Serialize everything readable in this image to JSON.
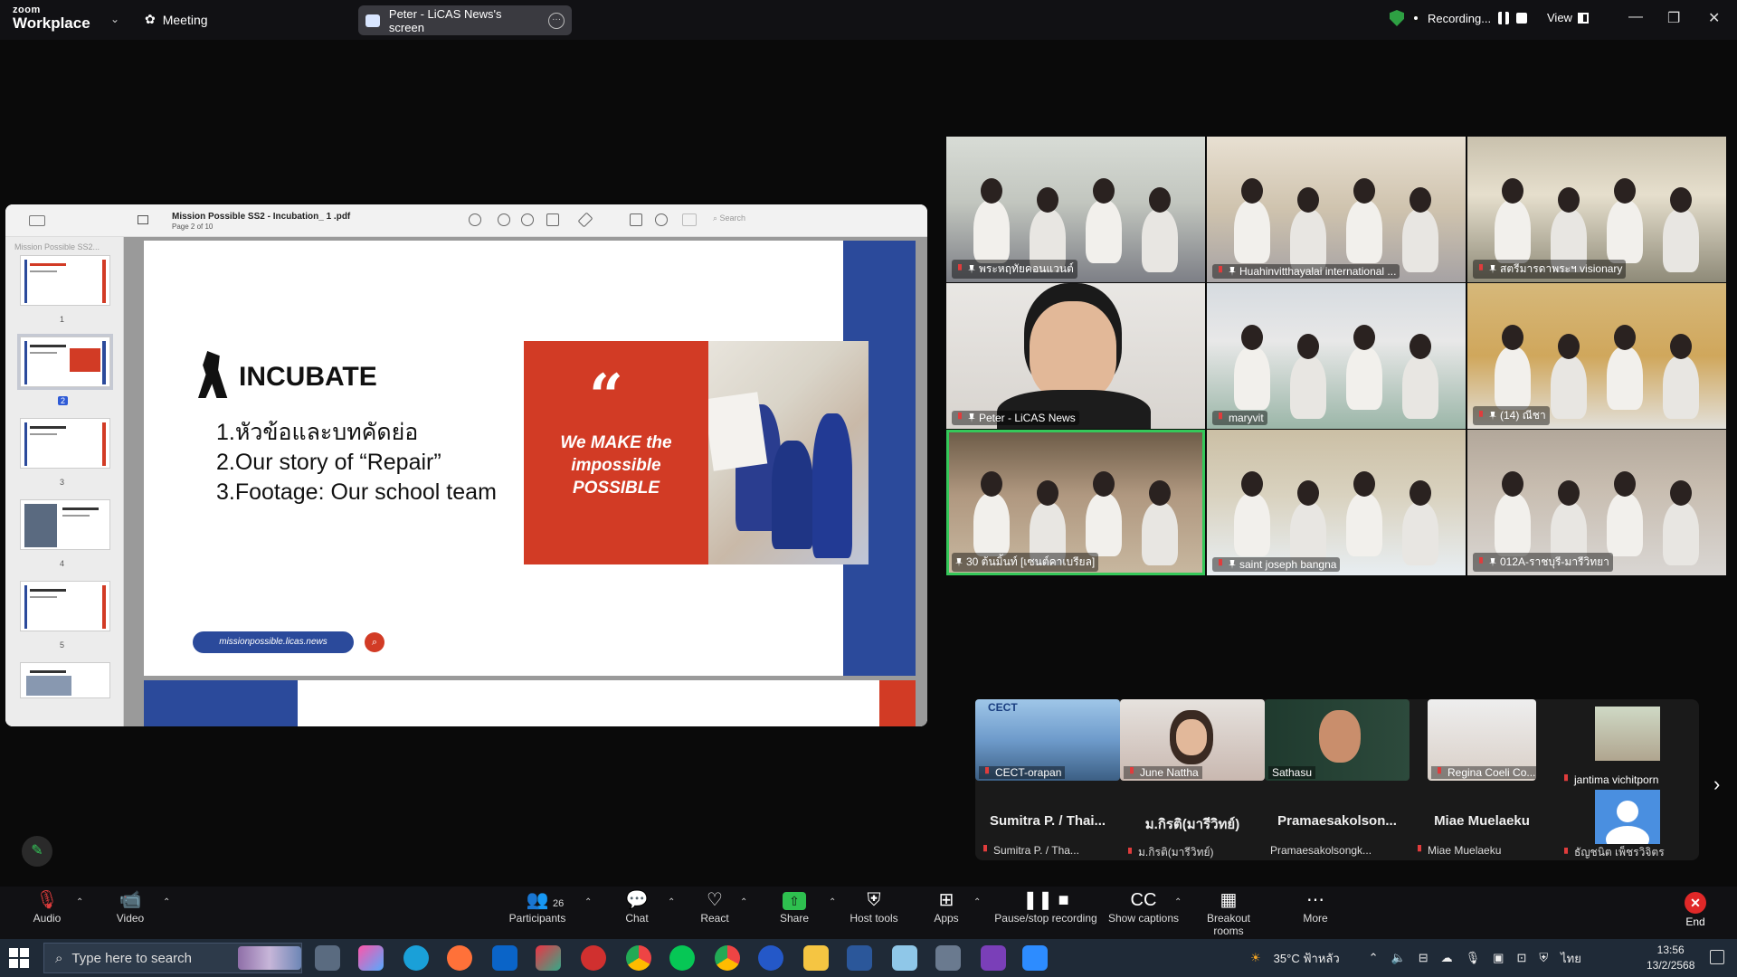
{
  "titlebar": {
    "brand_top": "zoom",
    "brand_main": "Workplace",
    "meeting_label": "Meeting",
    "share_tab_label": "Peter - LiCAS News's screen",
    "recording_label": "Recording...",
    "view_label": "View",
    "min": "—",
    "max": "❐",
    "close": "✕"
  },
  "pdf": {
    "title": "Mission Possible SS2 - Incubation_ 1 .pdf",
    "page_info": "Page 2 of 10",
    "search_placeholder": "Search",
    "sidebar_title": "Mission Possible SS2...",
    "thumbs": [
      "1",
      "2",
      "3",
      "4",
      "5"
    ],
    "selected_page": "2"
  },
  "slide": {
    "heading": "INCUBATE",
    "agenda": [
      "1.หัวข้อและบทคัดย่อ",
      "2.Our story of “Repair”",
      "3.Footage: Our school team"
    ],
    "quote_mark": "“",
    "quote_text": "We MAKE the impossible POSSIBLE",
    "url": "missionpossible.licas.news",
    "colors": {
      "blue": "#2b4a9b",
      "red": "#d23b25"
    }
  },
  "gallery": [
    {
      "name": "พระหฤทัยคอนแวนต์",
      "muted": true,
      "pinned": true
    },
    {
      "name": "Huahinvitthayalai international ...",
      "muted": true,
      "pinned": true
    },
    {
      "name": "สตรีมารดาพระฯ visionary",
      "muted": true,
      "pinned": true
    },
    {
      "name": "Peter - LiCAS News",
      "muted": true,
      "pinned": true
    },
    {
      "name": "maryvit",
      "muted": true,
      "pinned": false
    },
    {
      "name": "(14) ณีชา",
      "muted": true,
      "pinned": true
    },
    {
      "name": "30 ต้นมิ้นท์ [เซนต์คาเบรียล]",
      "muted": false,
      "pinned": true,
      "active": true
    },
    {
      "name": "saint joseph bangna",
      "muted": true,
      "pinned": true
    },
    {
      "name": "012A-ราชบุรี-มารีวิทยา",
      "muted": true,
      "pinned": true
    }
  ],
  "strip": {
    "video_tiles": [
      {
        "name": "CECT-orapan",
        "muted": true
      },
      {
        "name": "June Nattha",
        "muted": true
      },
      {
        "name": "Sathasu",
        "muted": false
      },
      {
        "name": "Regina Coeli Co...",
        "muted": true
      },
      {
        "name": "jantima vichitporn",
        "muted": true
      }
    ],
    "cect_logo": "CECT",
    "name_tiles": [
      {
        "display": "Sumitra P. / Thai...",
        "label": "Sumitra P. / Tha..."
      },
      {
        "display": "ม.กิรติ(มารีวิทย์)",
        "label": "ม.กิรติ(มารีวิทย์)"
      },
      {
        "display": "Pramaesakolson...",
        "label": "Pramaesakolsongk..."
      },
      {
        "display": "Miae Muelaeku",
        "label": "Miae Muelaeku"
      }
    ],
    "avatar_label": "ธัญชนิต เพ็ชรวิจิตร",
    "next": "›"
  },
  "controls": [
    {
      "label": "Audio",
      "icon": "🎙"
    },
    {
      "label": "Video",
      "icon": "📹"
    },
    {
      "label": "Participants",
      "icon": "👥"
    },
    {
      "label": "Chat",
      "icon": "💬"
    },
    {
      "label": "React",
      "icon": "♡"
    },
    {
      "label": "Share",
      "icon": "⇧"
    },
    {
      "label": "Host tools",
      "icon": "⛨"
    },
    {
      "label": "Apps",
      "icon": "⊞"
    },
    {
      "label": "Pause/stop recording",
      "icon": "❚❚ ■"
    },
    {
      "label": "Show captions",
      "icon": "CC"
    },
    {
      "label": "Breakout rooms",
      "icon": "▦"
    },
    {
      "label": "More",
      "icon": "⋯"
    }
  ],
  "participants_count": "26",
  "end_label": "End",
  "taskbar": {
    "search_placeholder": "Type here to search",
    "weather": "35°C ฟ้าหลัว",
    "lang": "ไทย",
    "time": "13:56",
    "date": "13/2/2568"
  }
}
